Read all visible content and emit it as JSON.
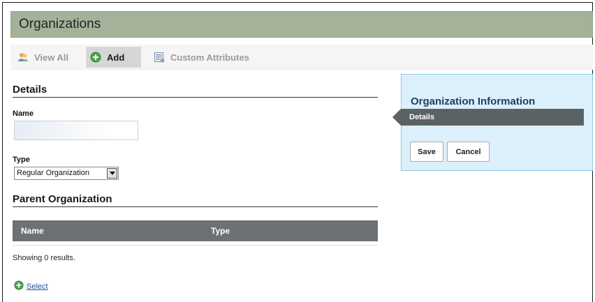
{
  "header": {
    "title": "Organizations"
  },
  "tabs": [
    {
      "label": "View All",
      "icon": "users-icon",
      "active": false
    },
    {
      "label": "Add",
      "icon": "add-circle-icon",
      "active": true
    },
    {
      "label": "Custom Attributes",
      "icon": "form-icon",
      "active": false
    }
  ],
  "details": {
    "heading": "Details",
    "name_label": "Name",
    "name_value": "",
    "type_label": "Type",
    "type_selected": "Regular Organization"
  },
  "parent": {
    "heading": "Parent Organization",
    "columns": [
      "Name",
      "Type"
    ],
    "rows": [],
    "results_text": "Showing 0 results.",
    "select_link": "Select"
  },
  "sidebar": {
    "title": "Organization Information",
    "nav_item": "Details",
    "save_label": "Save",
    "cancel_label": "Cancel"
  },
  "colors": {
    "title_bar": "#a4b29a",
    "info_panel": "#dcf0fc",
    "table_header": "#6d7174",
    "add_icon": "#4ba54b",
    "link": "#1d4f99"
  }
}
